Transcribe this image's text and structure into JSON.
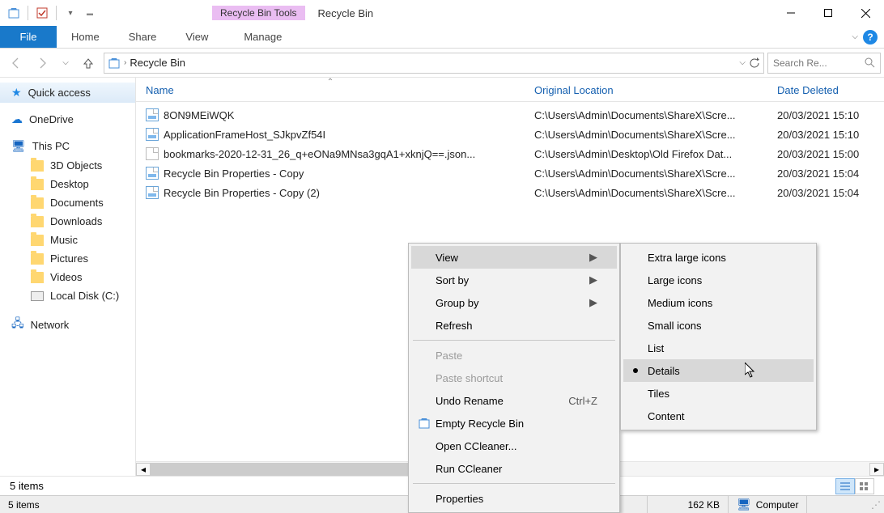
{
  "window": {
    "title": "Recycle Bin",
    "contextual_tab": "Recycle Bin Tools"
  },
  "ribbon": {
    "file": "File",
    "tabs": [
      "Home",
      "Share",
      "View"
    ],
    "ctx_tab": "Manage"
  },
  "nav": {
    "breadcrumb": "Recycle Bin",
    "search_placeholder": "Search Re..."
  },
  "sidebar": {
    "quick_access": "Quick access",
    "onedrive": "OneDrive",
    "this_pc": "This PC",
    "pc_items": [
      "3D Objects",
      "Desktop",
      "Documents",
      "Downloads",
      "Music",
      "Pictures",
      "Videos",
      "Local Disk (C:)"
    ],
    "network": "Network"
  },
  "columns": {
    "name": "Name",
    "loc": "Original Location",
    "date": "Date Deleted"
  },
  "files": [
    {
      "icon": "img",
      "name": "8ON9MEiWQK",
      "loc": "C:\\Users\\Admin\\Documents\\ShareX\\Scre...",
      "date": "20/03/2021 15:10"
    },
    {
      "icon": "img",
      "name": "ApplicationFrameHost_SJkpvZf54I",
      "loc": "C:\\Users\\Admin\\Documents\\ShareX\\Scre...",
      "date": "20/03/2021 15:10"
    },
    {
      "icon": "doc",
      "name": "bookmarks-2020-12-31_26_q+eONa9MNsa3gqA1+xknjQ==.json...",
      "loc": "C:\\Users\\Admin\\Desktop\\Old Firefox Dat...",
      "date": "20/03/2021 15:00"
    },
    {
      "icon": "img",
      "name": "Recycle Bin Properties - Copy",
      "loc": "C:\\Users\\Admin\\Documents\\ShareX\\Scre...",
      "date": "20/03/2021 15:04"
    },
    {
      "icon": "img",
      "name": "Recycle Bin Properties - Copy (2)",
      "loc": "C:\\Users\\Admin\\Documents\\ShareX\\Scre...",
      "date": "20/03/2021 15:04"
    }
  ],
  "context_menu": {
    "view": "View",
    "sort_by": "Sort by",
    "group_by": "Group by",
    "refresh": "Refresh",
    "paste": "Paste",
    "paste_shortcut": "Paste shortcut",
    "undo_rename": "Undo Rename",
    "undo_shortcut": "Ctrl+Z",
    "empty_bin": "Empty Recycle Bin",
    "open_ccleaner": "Open CCleaner...",
    "run_ccleaner": "Run CCleaner",
    "properties": "Properties"
  },
  "view_submenu": {
    "xl": "Extra large icons",
    "lg": "Large icons",
    "md": "Medium icons",
    "sm": "Small icons",
    "list": "List",
    "details": "Details",
    "tiles": "Tiles",
    "content": "Content"
  },
  "status": {
    "items": "5 items",
    "items2": "5 items",
    "size": "162 KB",
    "computer": "Computer"
  }
}
